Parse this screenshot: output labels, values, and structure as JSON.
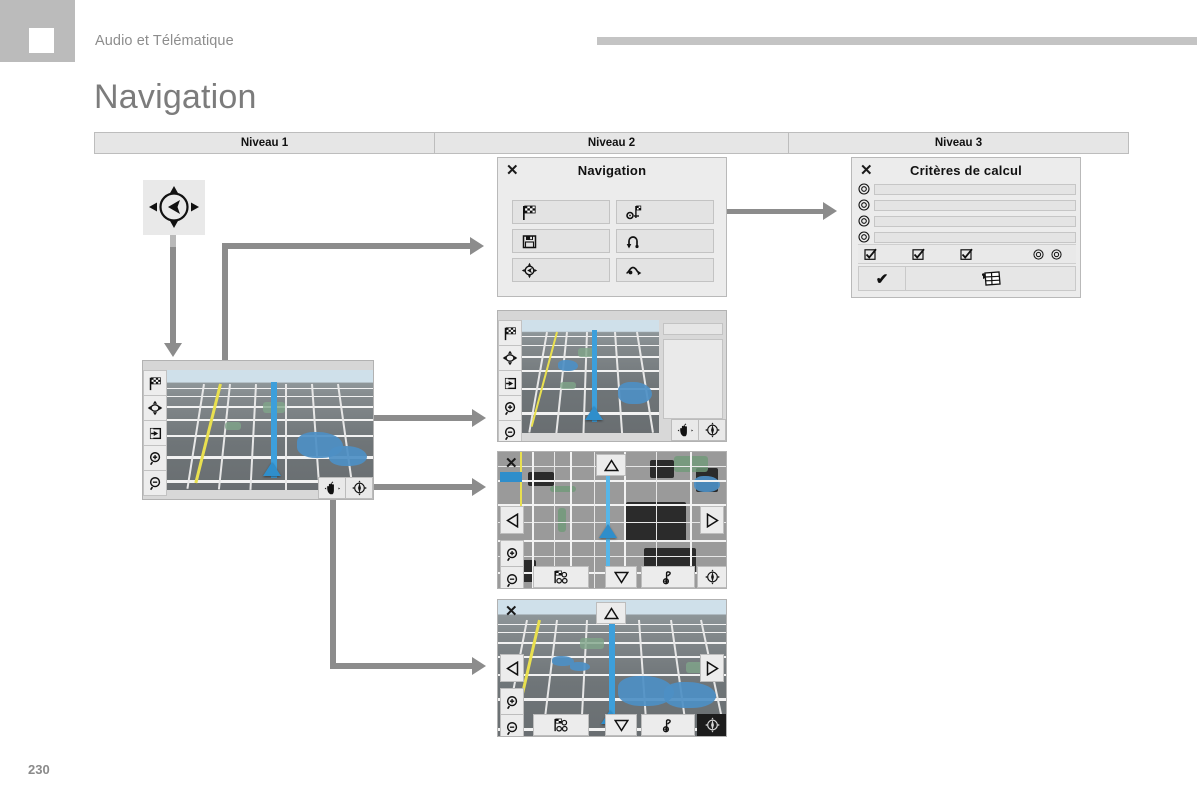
{
  "header": {
    "breadcrumb": "Audio et Télématique",
    "page_title": "Navigation",
    "page_number": "230"
  },
  "levels": [
    {
      "label": "Niveau 1"
    },
    {
      "label": "Niveau 2"
    },
    {
      "label": "Niveau 3"
    }
  ],
  "compass_widget": {
    "name": "navigation-joystick",
    "icon": "compass-arrow-icon"
  },
  "nav_panel": {
    "close_label": "✕",
    "title": "Navigation",
    "buttons": [
      {
        "icon": "checkered-flag-icon",
        "label": ""
      },
      {
        "icon": "route-criteria-gear-flag-icon",
        "label": ""
      },
      {
        "icon": "floppy-disk-save-icon",
        "label": ""
      },
      {
        "icon": "u-turn-detour-icon",
        "label": ""
      },
      {
        "icon": "compass-position-icon",
        "label": ""
      },
      {
        "icon": "road-route-icon",
        "label": ""
      }
    ]
  },
  "criteria_panel": {
    "close_label": "✕",
    "title": "Critères de calcul",
    "rows": [
      {
        "icon": "radio-button-icon",
        "value": ""
      },
      {
        "icon": "radio-button-icon",
        "value": ""
      },
      {
        "icon": "radio-button-icon",
        "value": ""
      },
      {
        "icon": "radio-button-icon",
        "value": ""
      }
    ],
    "option_icons": [
      {
        "icon": "checkbox-checked-icon"
      },
      {
        "icon": "checkbox-checked-icon"
      },
      {
        "icon": "checkbox-checked-icon"
      }
    ],
    "option_radios": [
      {
        "icon": "radio-button-icon"
      },
      {
        "icon": "radio-button-icon"
      }
    ],
    "footer": {
      "confirm_icon": "checkmark-icon",
      "confirm_label": "✔",
      "map_icon": "map-grid-hand-icon"
    }
  },
  "map_level1": {
    "name": "map-perspective-level1",
    "toolbar": [
      {
        "icon": "checkered-flag-icon"
      },
      {
        "icon": "pan-four-arrows-icon"
      },
      {
        "icon": "exit-arrow-icon"
      },
      {
        "icon": "zoom-in-icon"
      },
      {
        "icon": "zoom-out-icon"
      }
    ],
    "bottom_right": [
      {
        "icon": "hand-pan-icon"
      },
      {
        "icon": "compass-rose-icon"
      }
    ]
  },
  "map_level2_detail": {
    "name": "map-perspective-with-sidepanel",
    "toolbar": [
      {
        "icon": "checkered-flag-icon"
      },
      {
        "icon": "pan-four-arrows-icon"
      },
      {
        "icon": "exit-arrow-icon"
      },
      {
        "icon": "zoom-in-icon"
      },
      {
        "icon": "zoom-out-icon"
      }
    ],
    "side_panel": {
      "field_value": "",
      "list_value": ""
    },
    "bottom_right": [
      {
        "icon": "hand-pan-icon"
      },
      {
        "icon": "compass-rose-icon"
      }
    ]
  },
  "map_level2_topdown": {
    "name": "map-topdown-pan",
    "close_label": "✕",
    "pan_up_icon": "triangle-up-icon",
    "pan_down_icon": "triangle-down-icon",
    "pan_left_icon": "triangle-left-icon",
    "pan_right_icon": "triangle-right-icon",
    "toolbar": [
      {
        "icon": "zoom-in-icon"
      },
      {
        "icon": "zoom-out-icon"
      }
    ],
    "bottom": [
      {
        "icon": "poi-landmark-icon"
      },
      {
        "icon": "triangle-down-icon"
      },
      {
        "icon": "pin-flag-icon"
      },
      {
        "icon": "compass-rose-icon"
      }
    ]
  },
  "map_level2_perspective": {
    "name": "map-perspective-pan",
    "close_label": "✕",
    "pan_up_icon": "triangle-up-icon",
    "pan_down_icon": "triangle-down-icon",
    "pan_left_icon": "triangle-left-icon",
    "pan_right_icon": "triangle-right-icon",
    "toolbar": [
      {
        "icon": "zoom-in-icon"
      },
      {
        "icon": "zoom-out-icon"
      }
    ],
    "bottom": [
      {
        "icon": "poi-landmark-icon"
      },
      {
        "icon": "triangle-down-icon"
      },
      {
        "icon": "pin-flag-icon"
      },
      {
        "icon": "compass-rose-icon"
      }
    ]
  },
  "colors": {
    "connector": "#8c8c8c",
    "panel_bg": "#ececec",
    "route_blue": "#3d9fdb",
    "road_yellow": "#e9e04f",
    "water_blue": "#4d8fc4",
    "header_gray": "#bbbbbb",
    "title_gray": "#7c7c7c"
  }
}
